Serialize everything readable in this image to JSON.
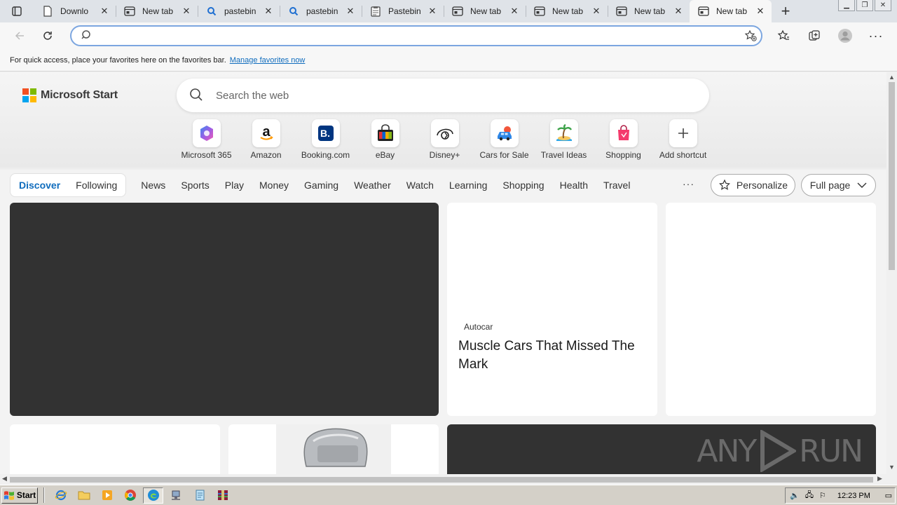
{
  "browser": {
    "tabs": [
      {
        "label": "Downlo",
        "icon": "document-icon",
        "active": false
      },
      {
        "label": "New tab",
        "icon": "newtab-icon",
        "active": false
      },
      {
        "label": "pastebin",
        "icon": "search-icon",
        "active": false
      },
      {
        "label": "pastebin",
        "icon": "search-icon",
        "active": false
      },
      {
        "label": "Pastebin",
        "icon": "pastebin-icon",
        "active": false
      },
      {
        "label": "New tab",
        "icon": "newtab-icon",
        "active": false
      },
      {
        "label": "New tab",
        "icon": "newtab-icon",
        "active": false
      },
      {
        "label": "New tab",
        "icon": "newtab-icon",
        "active": false
      },
      {
        "label": "New tab",
        "icon": "newtab-icon",
        "active": true
      }
    ],
    "address": {
      "value": "",
      "placeholder": ""
    },
    "favorites_bar": {
      "message": "For quick access, place your favorites here on the favorites bar.",
      "link": "Manage favorites now"
    }
  },
  "start_page": {
    "brand": "Microsoft Start",
    "brand_colors": [
      "#f25022",
      "#7fba00",
      "#00a4ef",
      "#ffb900"
    ],
    "search_placeholder": "Search the web",
    "shortcuts": [
      {
        "label": "Microsoft 365",
        "icon": "microsoft365-icon"
      },
      {
        "label": "Amazon",
        "icon": "amazon-icon"
      },
      {
        "label": "Booking.com",
        "icon": "booking-icon"
      },
      {
        "label": "eBay",
        "icon": "ebay-icon"
      },
      {
        "label": "Disney+",
        "icon": "disney-icon"
      },
      {
        "label": "Cars for Sale",
        "icon": "car-icon"
      },
      {
        "label": "Travel Ideas",
        "icon": "island-icon"
      },
      {
        "label": "Shopping",
        "icon": "shopping-bag-icon"
      },
      {
        "label": "Add shortcut",
        "icon": "plus-icon"
      }
    ],
    "feed_tabs": {
      "discover": "Discover",
      "following": "Following"
    },
    "nav": [
      "News",
      "Sports",
      "Play",
      "Money",
      "Gaming",
      "Weather",
      "Watch",
      "Learning",
      "Shopping",
      "Health",
      "Travel"
    ],
    "more": "···",
    "personalize": "Personalize",
    "full_page": "Full page",
    "cards": {
      "article": {
        "source": "Autocar",
        "headline": "Muscle Cars That Missed The Mark"
      },
      "watermark": "ANY RUN"
    },
    "accent_color": "#0f6cbd"
  },
  "taskbar": {
    "start_label": "Start",
    "clock": "12:23 PM"
  }
}
